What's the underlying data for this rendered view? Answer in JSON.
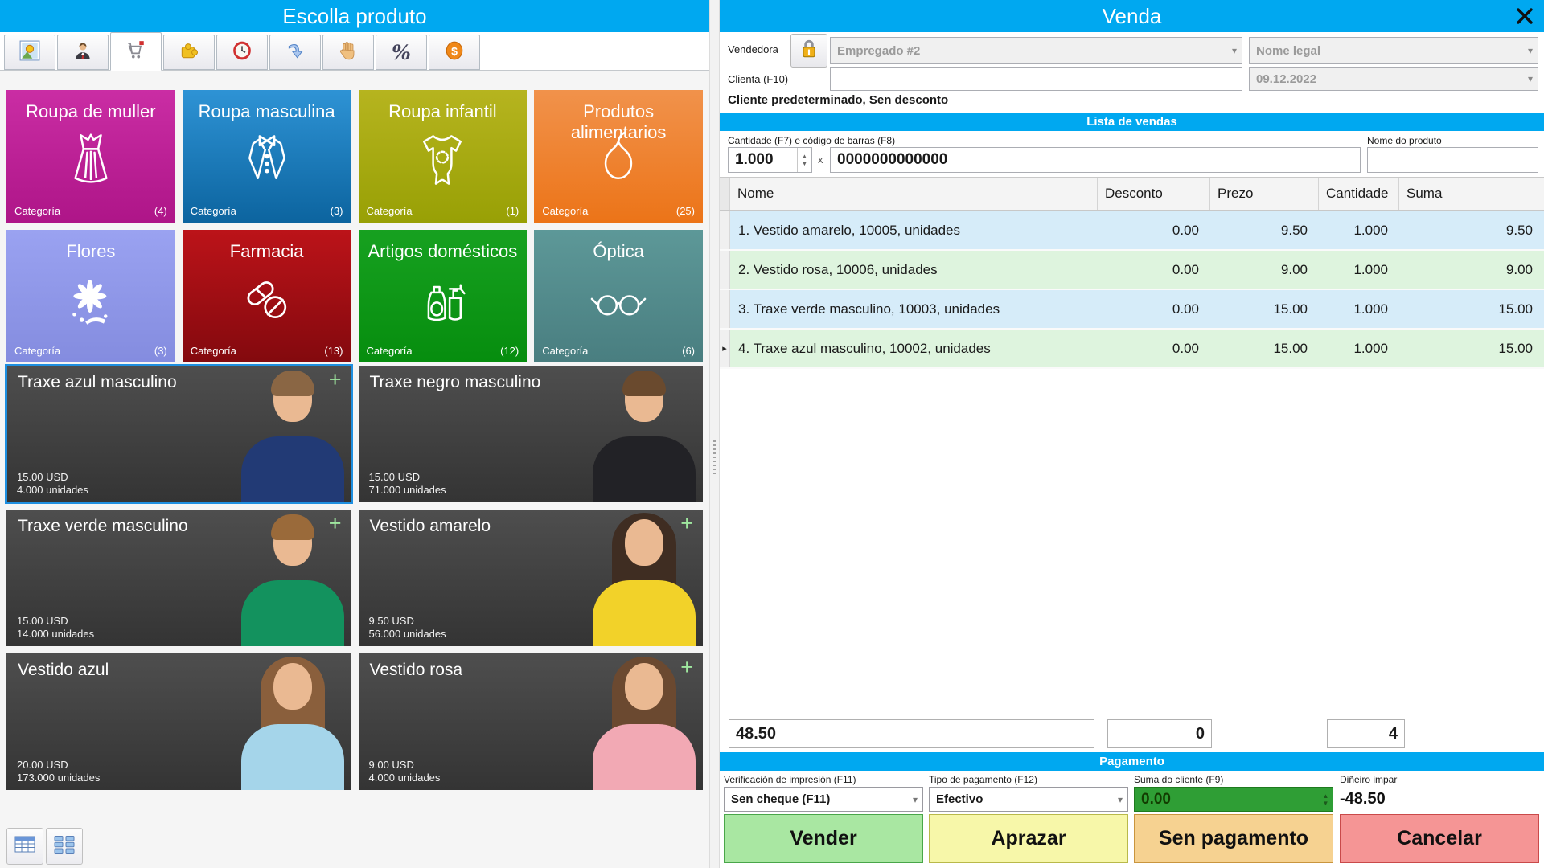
{
  "accent_color": "#00a8f0",
  "left_panel": {
    "title": "Escolla produto",
    "toolbar": [
      {
        "icon": "picture-icon"
      },
      {
        "icon": "person-icon"
      },
      {
        "icon": "cart-icon",
        "selected": true
      },
      {
        "icon": "puzzle-icon"
      },
      {
        "icon": "clock-icon"
      },
      {
        "icon": "undo-arrow-icon"
      },
      {
        "icon": "hand-icon"
      },
      {
        "icon": "percent-icon",
        "glyph": "%"
      },
      {
        "icon": "dollar-icon"
      }
    ],
    "category_label": "Categoría",
    "categories": [
      {
        "name": "Roupa de muller",
        "count": "(4)",
        "icon": "dress-icon",
        "colors": {
          "top": "#ca2da4",
          "bottom": "#ae1588"
        }
      },
      {
        "name": "Roupa masculina",
        "count": "(3)",
        "icon": "tuxedo-icon",
        "colors": {
          "top": "#2e93d5",
          "bottom": "#0c649f"
        }
      },
      {
        "name": "Roupa infantil",
        "count": "(1)",
        "icon": "baby-onesie-icon",
        "colors": {
          "top": "#b6b41f",
          "bottom": "#98a005"
        }
      },
      {
        "name": "Produtos alimentarios",
        "count": "(25)",
        "icon": "pear-icon",
        "colors": {
          "top": "#f1924b",
          "bottom": "#ec7418"
        }
      },
      {
        "name": "Flores",
        "count": "(3)",
        "icon": "flower-icon",
        "colors": {
          "top": "#9aa2f1",
          "bottom": "#848cdf"
        }
      },
      {
        "name": "Farmacia",
        "count": "(13)",
        "icon": "pills-icon",
        "colors": {
          "top": "#bc1319",
          "bottom": "#83090e"
        }
      },
      {
        "name": "Artigos domésticos",
        "count": "(12)",
        "icon": "cleaning-icon",
        "colors": {
          "top": "#17a120",
          "bottom": "#068d0e"
        }
      },
      {
        "name": "Óptica",
        "count": "(6)",
        "icon": "glasses-icon",
        "colors": {
          "top": "#5d9898",
          "bottom": "#497e80"
        }
      }
    ],
    "products": [
      {
        "name": "Traxe azul masculino",
        "price": "15.00 USD",
        "units": "4.000 unidades",
        "plus": "+",
        "selected": true,
        "photo": {
          "skin": "#eab992",
          "hair": "#8a6644",
          "outfit": "#223a75",
          "hair_class": "hair short"
        }
      },
      {
        "name": "Traxe negro masculino",
        "price": "15.00 USD",
        "units": "71.000 unidades",
        "plus": "",
        "photo": {
          "skin": "#eab992",
          "hair": "#6a4a2e",
          "outfit": "#222226",
          "hair_class": "hair short"
        }
      },
      {
        "name": "Traxe verde masculino",
        "price": "15.00 USD",
        "units": "14.000 unidades",
        "plus": "+",
        "photo": {
          "skin": "#eab992",
          "hair": "#9a6a3a",
          "outfit": "#13925e",
          "hair_class": "hair short"
        }
      },
      {
        "name": "Vestido amarelo",
        "price": "9.50 USD",
        "units": "56.000 unidades",
        "plus": "+",
        "photo": {
          "skin": "#eab992",
          "hair": "#3f2d22",
          "outfit": "#f2d229",
          "hair_class": "hair long"
        }
      },
      {
        "name": "Vestido azul",
        "price": "20.00 USD",
        "units": "173.000 unidades",
        "plus": "",
        "photo": {
          "skin": "#eab992",
          "hair": "#8a5f3c",
          "outfit": "#a5d5ea",
          "hair_class": "hair long"
        }
      },
      {
        "name": "Vestido rosa",
        "price": "9.00 USD",
        "units": "4.000 unidades",
        "plus": "+",
        "photo": {
          "skin": "#eab992",
          "hair": "#6b4930",
          "outfit": "#f2a9b4",
          "hair_class": "hair long"
        }
      }
    ],
    "view_buttons": [
      {
        "icon": "table-view-icon"
      },
      {
        "icon": "tiles-view-icon"
      }
    ]
  },
  "right_panel": {
    "title": "Venda",
    "form": {
      "vendedora_label": "Vendedora",
      "vendedora_value": "Empregado #2",
      "nome_legal_value": "Nome legal",
      "clienta_label": "Clienta (F10)",
      "clienta_value": "",
      "date_value": "09.12.2022",
      "status_text": "Cliente predeterminado, Sen desconto"
    },
    "lista_title": "Lista de vendas",
    "entry": {
      "qty_label": "Cantidade (F7) e código de barras (F8)",
      "qty_value": "1.000",
      "times_label": "x",
      "barcode_value": "0000000000000",
      "product_label": "Nome do produto",
      "product_value": ""
    },
    "table": {
      "columns": [
        "Nome",
        "Desconto",
        "Prezo",
        "Cantidade",
        "Suma"
      ],
      "rows": [
        {
          "marker": "",
          "nome": "1. Vestido amarelo, 10005, unidades",
          "desconto": "0.00",
          "prezo": "9.50",
          "cantidade": "1.000",
          "suma": "9.50"
        },
        {
          "marker": "",
          "nome": "2. Vestido rosa, 10006, unidades",
          "desconto": "0.00",
          "prezo": "9.00",
          "cantidade": "1.000",
          "suma": "9.00"
        },
        {
          "marker": "",
          "nome": "3. Traxe verde masculino, 10003, unidades",
          "desconto": "0.00",
          "prezo": "15.00",
          "cantidade": "1.000",
          "suma": "15.00"
        },
        {
          "marker": "▸",
          "nome": "4. Traxe azul masculino, 10002, unidades",
          "desconto": "0.00",
          "prezo": "15.00",
          "cantidade": "1.000",
          "suma": "15.00"
        }
      ]
    },
    "totals": {
      "total": "48.50",
      "discount": "0",
      "count": "4"
    },
    "payment": {
      "title": "Pagamento",
      "verification_label": "Verificación de impresión (F11)",
      "verification_value": "Sen cheque (F11)",
      "type_label": "Tipo de pagamento (F12)",
      "type_value": "Efectivo",
      "customer_sum_label": "Suma do cliente (F9)",
      "customer_sum_value": "0.00",
      "customer_sum_bg": "#2f9e35",
      "change_label": "Diñeiro impar",
      "change_value": "-48.50",
      "buttons": [
        {
          "label": "Vender",
          "bg": "#a9e7a2",
          "border": "#49a649"
        },
        {
          "label": "Aprazar",
          "bg": "#f7f7a9",
          "border": "#b9b94a"
        },
        {
          "label": "Sen pagamento",
          "bg": "#f6d291",
          "border": "#c9953e"
        },
        {
          "label": "Cancelar",
          "bg": "#f59595",
          "border": "#c94a4a"
        }
      ]
    }
  }
}
